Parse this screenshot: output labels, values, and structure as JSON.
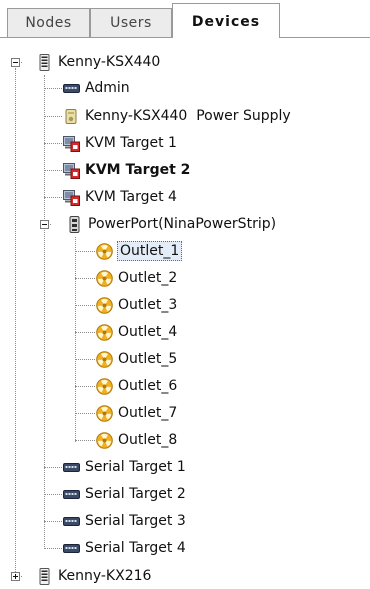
{
  "tabs": [
    {
      "label": "Nodes"
    },
    {
      "label": "Users"
    },
    {
      "label": "Devices"
    }
  ],
  "tree": {
    "root1": {
      "label": "Kenny-KSX440",
      "icon": "device-tower-icon",
      "children": [
        {
          "label": "Admin",
          "icon": "serial-port-icon"
        },
        {
          "label": "Kenny-KSX440  Power Supply",
          "icon": "power-supply-icon"
        },
        {
          "label": "KVM Target 1",
          "icon": "kvm-target-icon"
        },
        {
          "label": "KVM Target 2",
          "icon": "kvm-target-icon"
        },
        {
          "label": "KVM Target 4",
          "icon": "kvm-target-icon"
        },
        {
          "label": "PowerPort(NinaPowerStrip)",
          "icon": "power-strip-icon",
          "children": [
            {
              "label": "Outlet_1",
              "icon": "outlet-icon"
            },
            {
              "label": "Outlet_2",
              "icon": "outlet-icon"
            },
            {
              "label": "Outlet_3",
              "icon": "outlet-icon"
            },
            {
              "label": "Outlet_4",
              "icon": "outlet-icon"
            },
            {
              "label": "Outlet_5",
              "icon": "outlet-icon"
            },
            {
              "label": "Outlet_6",
              "icon": "outlet-icon"
            },
            {
              "label": "Outlet_7",
              "icon": "outlet-icon"
            },
            {
              "label": "Outlet_8",
              "icon": "outlet-icon"
            }
          ]
        },
        {
          "label": "Serial Target 1",
          "icon": "serial-port-icon"
        },
        {
          "label": "Serial Target 2",
          "icon": "serial-port-icon"
        },
        {
          "label": "Serial Target 3",
          "icon": "serial-port-icon"
        },
        {
          "label": "Serial Target 4",
          "icon": "serial-port-icon"
        }
      ]
    },
    "root2": {
      "label": "Kenny-KX216",
      "icon": "device-tower-icon"
    }
  },
  "colors": {
    "outlet": "#f2b01e",
    "kvm_badge": "#d42a2a",
    "selection": "#e3ecf7"
  }
}
